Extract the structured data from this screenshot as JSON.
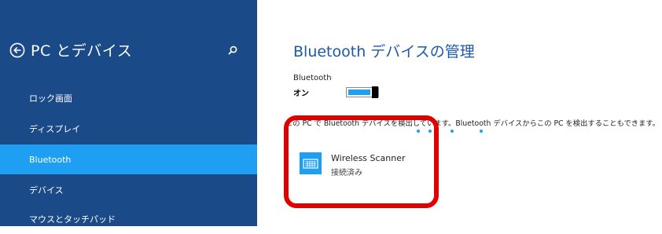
{
  "sidebar": {
    "title": "PC とデバイス",
    "items": [
      {
        "label": "ロック画面"
      },
      {
        "label": "ディスプレイ"
      },
      {
        "label": "Bluetooth"
      },
      {
        "label": "デバイス"
      },
      {
        "label": "マウスとタッチパッド"
      }
    ],
    "selected_item": "Bluetooth"
  },
  "main": {
    "title": "Bluetooth デバイスの管理",
    "bluetooth_label": "Bluetooth",
    "bluetooth_state": "オン",
    "description": "この PC で Bluetooth デバイスを検出しています。Bluetooth デバイスからこの PC を検出することもできます。",
    "devices": [
      {
        "name": "Wireless Scanner",
        "status": "接続済み",
        "icon": "keyboard-icon"
      }
    ]
  },
  "colors": {
    "sidebar_bg": "#1b4a88",
    "accent": "#1e9ff2",
    "title_blue": "#1a5aa8",
    "highlight_red": "#e00000"
  }
}
